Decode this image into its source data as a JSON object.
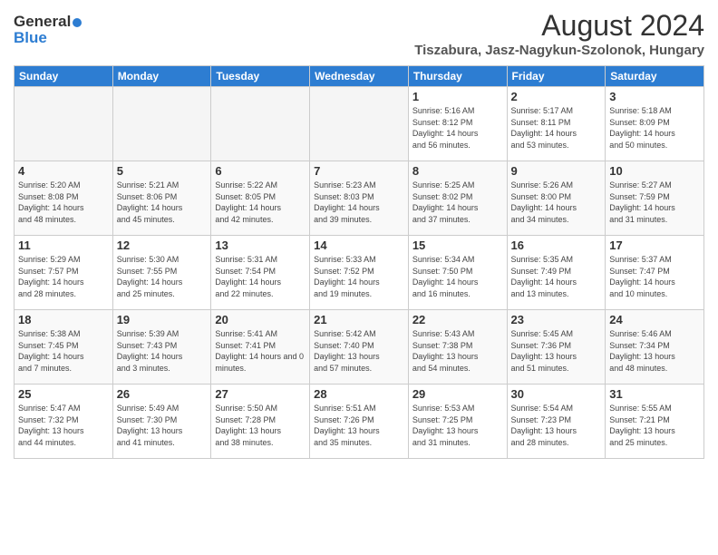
{
  "header": {
    "logo_general": "General",
    "logo_blue": "Blue",
    "month": "August 2024",
    "location": "Tiszabura, Jasz-Nagykun-Szolonok, Hungary"
  },
  "weekdays": [
    "Sunday",
    "Monday",
    "Tuesday",
    "Wednesday",
    "Thursday",
    "Friday",
    "Saturday"
  ],
  "weeks": [
    [
      {
        "day": "",
        "info": ""
      },
      {
        "day": "",
        "info": ""
      },
      {
        "day": "",
        "info": ""
      },
      {
        "day": "",
        "info": ""
      },
      {
        "day": "1",
        "info": "Sunrise: 5:16 AM\nSunset: 8:12 PM\nDaylight: 14 hours\nand 56 minutes."
      },
      {
        "day": "2",
        "info": "Sunrise: 5:17 AM\nSunset: 8:11 PM\nDaylight: 14 hours\nand 53 minutes."
      },
      {
        "day": "3",
        "info": "Sunrise: 5:18 AM\nSunset: 8:09 PM\nDaylight: 14 hours\nand 50 minutes."
      }
    ],
    [
      {
        "day": "4",
        "info": "Sunrise: 5:20 AM\nSunset: 8:08 PM\nDaylight: 14 hours\nand 48 minutes."
      },
      {
        "day": "5",
        "info": "Sunrise: 5:21 AM\nSunset: 8:06 PM\nDaylight: 14 hours\nand 45 minutes."
      },
      {
        "day": "6",
        "info": "Sunrise: 5:22 AM\nSunset: 8:05 PM\nDaylight: 14 hours\nand 42 minutes."
      },
      {
        "day": "7",
        "info": "Sunrise: 5:23 AM\nSunset: 8:03 PM\nDaylight: 14 hours\nand 39 minutes."
      },
      {
        "day": "8",
        "info": "Sunrise: 5:25 AM\nSunset: 8:02 PM\nDaylight: 14 hours\nand 37 minutes."
      },
      {
        "day": "9",
        "info": "Sunrise: 5:26 AM\nSunset: 8:00 PM\nDaylight: 14 hours\nand 34 minutes."
      },
      {
        "day": "10",
        "info": "Sunrise: 5:27 AM\nSunset: 7:59 PM\nDaylight: 14 hours\nand 31 minutes."
      }
    ],
    [
      {
        "day": "11",
        "info": "Sunrise: 5:29 AM\nSunset: 7:57 PM\nDaylight: 14 hours\nand 28 minutes."
      },
      {
        "day": "12",
        "info": "Sunrise: 5:30 AM\nSunset: 7:55 PM\nDaylight: 14 hours\nand 25 minutes."
      },
      {
        "day": "13",
        "info": "Sunrise: 5:31 AM\nSunset: 7:54 PM\nDaylight: 14 hours\nand 22 minutes."
      },
      {
        "day": "14",
        "info": "Sunrise: 5:33 AM\nSunset: 7:52 PM\nDaylight: 14 hours\nand 19 minutes."
      },
      {
        "day": "15",
        "info": "Sunrise: 5:34 AM\nSunset: 7:50 PM\nDaylight: 14 hours\nand 16 minutes."
      },
      {
        "day": "16",
        "info": "Sunrise: 5:35 AM\nSunset: 7:49 PM\nDaylight: 14 hours\nand 13 minutes."
      },
      {
        "day": "17",
        "info": "Sunrise: 5:37 AM\nSunset: 7:47 PM\nDaylight: 14 hours\nand 10 minutes."
      }
    ],
    [
      {
        "day": "18",
        "info": "Sunrise: 5:38 AM\nSunset: 7:45 PM\nDaylight: 14 hours\nand 7 minutes."
      },
      {
        "day": "19",
        "info": "Sunrise: 5:39 AM\nSunset: 7:43 PM\nDaylight: 14 hours\nand 3 minutes."
      },
      {
        "day": "20",
        "info": "Sunrise: 5:41 AM\nSunset: 7:41 PM\nDaylight: 14 hours and 0 minutes."
      },
      {
        "day": "21",
        "info": "Sunrise: 5:42 AM\nSunset: 7:40 PM\nDaylight: 13 hours\nand 57 minutes."
      },
      {
        "day": "22",
        "info": "Sunrise: 5:43 AM\nSunset: 7:38 PM\nDaylight: 13 hours\nand 54 minutes."
      },
      {
        "day": "23",
        "info": "Sunrise: 5:45 AM\nSunset: 7:36 PM\nDaylight: 13 hours\nand 51 minutes."
      },
      {
        "day": "24",
        "info": "Sunrise: 5:46 AM\nSunset: 7:34 PM\nDaylight: 13 hours\nand 48 minutes."
      }
    ],
    [
      {
        "day": "25",
        "info": "Sunrise: 5:47 AM\nSunset: 7:32 PM\nDaylight: 13 hours\nand 44 minutes."
      },
      {
        "day": "26",
        "info": "Sunrise: 5:49 AM\nSunset: 7:30 PM\nDaylight: 13 hours\nand 41 minutes."
      },
      {
        "day": "27",
        "info": "Sunrise: 5:50 AM\nSunset: 7:28 PM\nDaylight: 13 hours\nand 38 minutes."
      },
      {
        "day": "28",
        "info": "Sunrise: 5:51 AM\nSunset: 7:26 PM\nDaylight: 13 hours\nand 35 minutes."
      },
      {
        "day": "29",
        "info": "Sunrise: 5:53 AM\nSunset: 7:25 PM\nDaylight: 13 hours\nand 31 minutes."
      },
      {
        "day": "30",
        "info": "Sunrise: 5:54 AM\nSunset: 7:23 PM\nDaylight: 13 hours\nand 28 minutes."
      },
      {
        "day": "31",
        "info": "Sunrise: 5:55 AM\nSunset: 7:21 PM\nDaylight: 13 hours\nand 25 minutes."
      }
    ]
  ]
}
